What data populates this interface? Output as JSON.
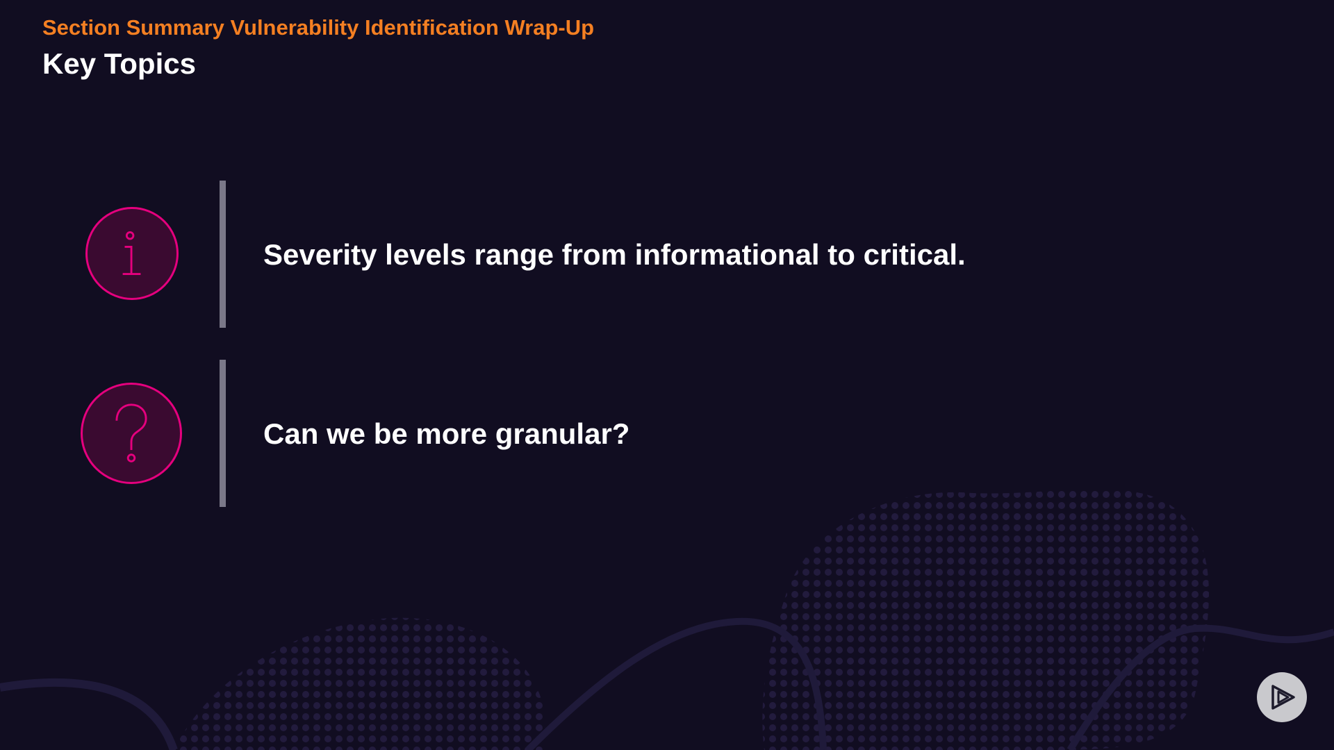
{
  "header": {
    "section_title": "Section Summary Vulnerability Identification Wrap-Up",
    "page_title": "Key Topics"
  },
  "topics": [
    {
      "icon": "info-icon",
      "text": "Severity levels range from informational to critical."
    },
    {
      "icon": "question-icon",
      "text": "Can we be more granular?"
    }
  ],
  "controls": {
    "play_icon": "play-icon"
  },
  "colors": {
    "background": "#110d21",
    "accent_orange": "#f47f22",
    "icon_pink": "#e5007e",
    "icon_fill": "#3a0a30",
    "divider": "#7b7889",
    "play_button": "#c9c9cd"
  }
}
